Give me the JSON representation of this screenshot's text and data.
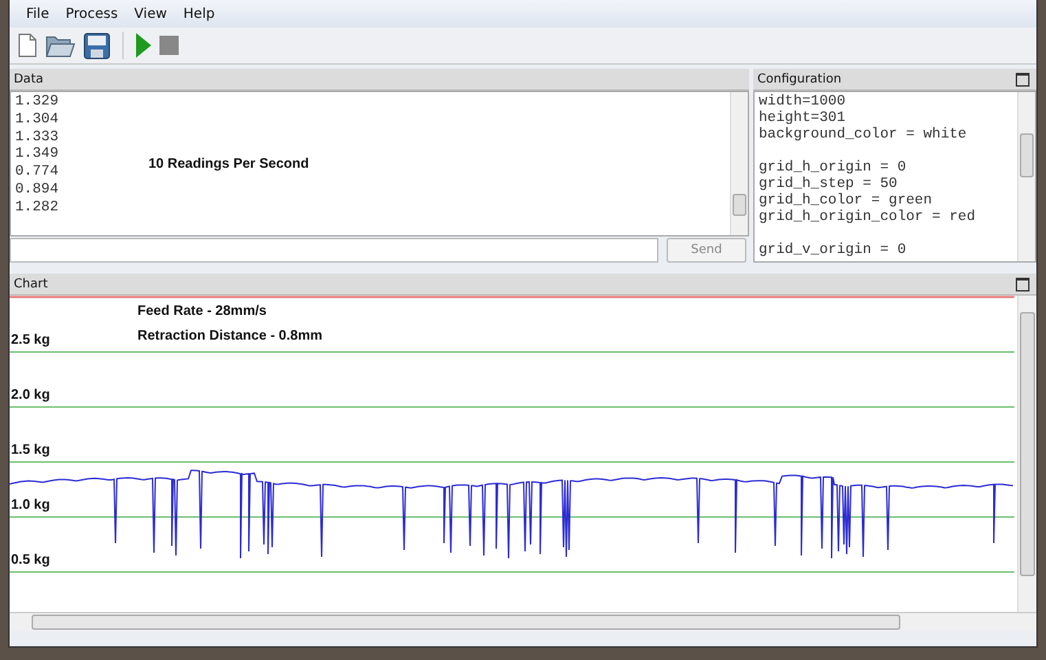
{
  "menu": [
    "File",
    "Process",
    "View",
    "Help"
  ],
  "toolbar": [
    {
      "kind": "new"
    },
    {
      "kind": "open"
    },
    {
      "kind": "save"
    },
    {
      "kind": "run"
    },
    {
      "kind": "stop"
    }
  ],
  "data_panel": {
    "title": "Data",
    "lines": [
      "1.329",
      "1.304",
      "1.333",
      "1.349",
      "0.774",
      "0.894",
      "1.282"
    ],
    "note": "10 Readings Per Second",
    "send_button": "Send"
  },
  "config_panel": {
    "title": "Configuration",
    "groups": [
      [
        "width=1000",
        "height=301",
        "background_color = white"
      ],
      [
        "grid_h_origin = 0",
        "grid_h_step = 50",
        "grid_h_color = green",
        "grid_h_origin_color = red"
      ],
      [
        "grid_v_origin = 0"
      ]
    ]
  },
  "chart_panel": {
    "title": "Chart",
    "annotations": [
      "Feed Rate - 28mm/s",
      "Retraction Distance - 0.8mm"
    ],
    "grid_labels": [
      "2.5 kg",
      "2.0 kg",
      "1.5 kg",
      "1.0 kg",
      "0.5 kg"
    ]
  }
}
